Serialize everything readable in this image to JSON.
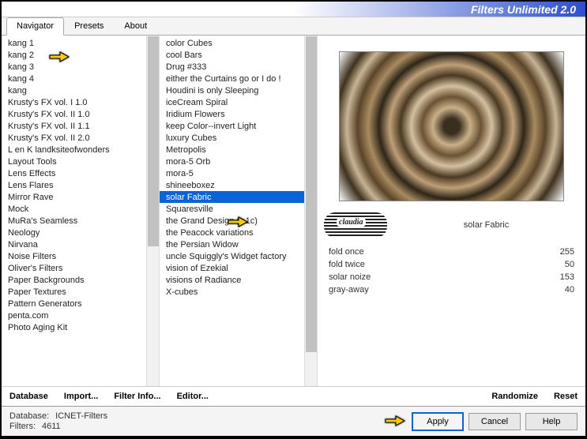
{
  "title": "Filters Unlimited 2.0",
  "tabs": [
    "Navigator",
    "Presets",
    "About"
  ],
  "activeTab": 0,
  "navigator": {
    "items": [
      "kang 1",
      "kang 2",
      "kang 3",
      "kang 4",
      "kang",
      "Krusty's FX vol. I 1.0",
      "Krusty's FX vol. II 1.0",
      "Krusty's FX vol. II 1.1",
      "Krusty's FX vol. II 2.0",
      "L en K landksiteofwonders",
      "Layout Tools",
      "Lens Effects",
      "Lens Flares",
      "Mirror Rave",
      "Mock",
      "MuRa's Seamless",
      "Neology",
      "Nirvana",
      "Noise Filters",
      "Oliver's Filters",
      "Paper Backgrounds",
      "Paper Textures",
      "Pattern Generators",
      "penta.com",
      "Photo Aging Kit"
    ]
  },
  "filters": {
    "items": [
      "color Cubes",
      "cool Bars",
      "Drug #333",
      "either the Curtains go or I do !",
      "Houdini is only Sleeping",
      "iceCream Spiral",
      "Iridium Flowers",
      "keep Color--invert Light",
      "luxury Cubes",
      "Metropolis",
      "mora-5 Orb",
      "mora-5",
      "shineeboxez",
      "solar Fabric",
      "Squaresville",
      "the Grand Design     (v.1c)",
      "the Peacock variations",
      "the Persian Widow",
      "uncle Squiggly's Widget factory",
      "vision of Ezekial",
      "visions of Radiance",
      "X-cubes"
    ],
    "selectedIndex": 13
  },
  "selectedFilter": "solar Fabric",
  "params": [
    {
      "name": "fold once",
      "value": 255
    },
    {
      "name": "fold twice",
      "value": 50
    },
    {
      "name": "solar noize",
      "value": 153
    },
    {
      "name": "gray-away",
      "value": 40
    }
  ],
  "bottomBar": {
    "database": "Database",
    "import": "Import...",
    "filterInfo": "Filter Info...",
    "editor": "Editor...",
    "randomize": "Randomize",
    "reset": "Reset"
  },
  "footer": {
    "dbLabel": "Database:",
    "dbValue": "ICNET-Filters",
    "filtersLabel": "Filters:",
    "filtersValue": "4611",
    "apply": "Apply",
    "cancel": "Cancel",
    "help": "Help"
  },
  "pointerIcon": "pointing-hand-icon"
}
